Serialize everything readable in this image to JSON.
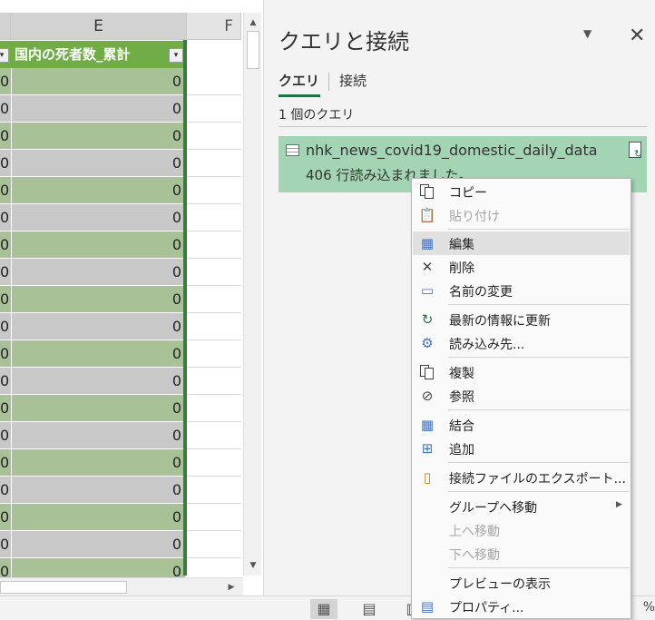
{
  "spreadsheet": {
    "columns": [
      "E",
      "F"
    ],
    "header_label": "国内の死者数_累計",
    "d_values": [
      "0",
      "0",
      "0",
      "0",
      "0",
      "0",
      "0",
      "0",
      "0",
      "0",
      "0",
      "0",
      "0",
      "0",
      "0",
      "0",
      "0",
      "0",
      "0"
    ],
    "e_values": [
      "0",
      "0",
      "0",
      "0",
      "0",
      "0",
      "0",
      "0",
      "0",
      "0",
      "0",
      "0",
      "0",
      "0",
      "0",
      "0",
      "0",
      "0",
      "0"
    ]
  },
  "statusbar": {
    "zoom": "%"
  },
  "pane": {
    "title": "クエリと接続",
    "tabs": [
      {
        "label": "クエリ",
        "active": true
      },
      {
        "label": "接続",
        "active": false
      }
    ],
    "query_count": "1 個のクエリ",
    "query": {
      "name": "nhk_news_covid19_domestic_daily_data",
      "status": "406 行読み込まれました。"
    }
  },
  "context_menu": {
    "items": [
      {
        "label": "コピー",
        "icon": "copy-icon",
        "enabled": true
      },
      {
        "label": "貼り付け",
        "icon": "paste-icon",
        "enabled": false
      },
      {
        "label": "編集",
        "icon": "edit-icon",
        "enabled": true,
        "highlighted": true
      },
      {
        "label": "削除",
        "icon": "delete-icon",
        "enabled": true
      },
      {
        "label": "名前の変更",
        "icon": "rename-icon",
        "enabled": true
      },
      {
        "label": "最新の情報に更新",
        "icon": "refresh-icon",
        "enabled": true
      },
      {
        "label": "読み込み先...",
        "icon": "load-to-icon",
        "enabled": true
      },
      {
        "label": "複製",
        "icon": "duplicate-icon",
        "enabled": true
      },
      {
        "label": "参照",
        "icon": "reference-icon",
        "enabled": true
      },
      {
        "label": "結合",
        "icon": "merge-icon",
        "enabled": true
      },
      {
        "label": "追加",
        "icon": "append-icon",
        "enabled": true
      },
      {
        "label": "接続ファイルのエクスポート...",
        "icon": "export-connection-icon",
        "enabled": true
      },
      {
        "label": "グループへ移動",
        "icon": "",
        "enabled": true,
        "submenu": true
      },
      {
        "label": "上へ移動",
        "icon": "",
        "enabled": false
      },
      {
        "label": "下へ移動",
        "icon": "",
        "enabled": false
      },
      {
        "label": "プレビューの表示",
        "icon": "",
        "enabled": true
      },
      {
        "label": "プロパティ...",
        "icon": "properties-icon",
        "enabled": true
      }
    ]
  }
}
